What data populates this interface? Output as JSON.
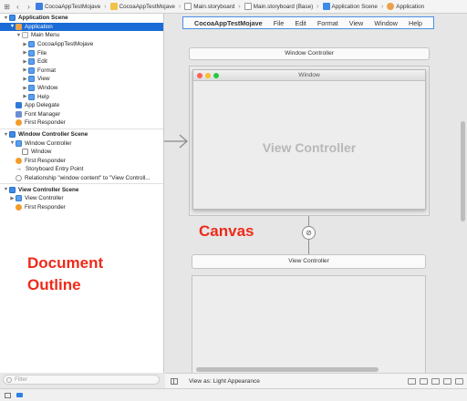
{
  "jumpbar": {
    "crumbs": [
      "CocoaAppTestMojave",
      "CocoaAppTestMojave",
      "Main.storyboard",
      "Main.storyboard (Base)",
      "Application Scene",
      "Application"
    ]
  },
  "outline": {
    "rows": [
      {
        "label": "Application Scene",
        "icon": "scene-icon",
        "tri": "▼"
      },
      {
        "label": "Application",
        "icon": "application-icon",
        "tri": "▼"
      },
      {
        "label": "Main Menu",
        "icon": "menu-icon",
        "tri": "▼"
      },
      {
        "label": "CocoaAppTestMojave",
        "icon": "menu-item-icon",
        "tri": "▶"
      },
      {
        "label": "File",
        "icon": "menu-item-icon",
        "tri": "▶"
      },
      {
        "label": "Edit",
        "icon": "menu-item-icon",
        "tri": "▶"
      },
      {
        "label": "Format",
        "icon": "menu-item-icon",
        "tri": "▶"
      },
      {
        "label": "View",
        "icon": "menu-item-icon",
        "tri": "▶"
      },
      {
        "label": "Window",
        "icon": "menu-item-icon",
        "tri": "▶"
      },
      {
        "label": "Help",
        "icon": "menu-item-icon",
        "tri": "▶"
      },
      {
        "label": "App Delegate",
        "icon": "cube-icon",
        "tri": ""
      },
      {
        "label": "Font Manager",
        "icon": "font-manager-icon",
        "tri": ""
      },
      {
        "label": "First Responder",
        "icon": "first-responder-icon",
        "tri": ""
      },
      {
        "label": "Window Controller Scene",
        "icon": "scene-icon",
        "tri": "▼"
      },
      {
        "label": "Window Controller",
        "icon": "window-controller-icon",
        "tri": "▼"
      },
      {
        "label": "Window",
        "icon": "window-icon",
        "tri": ""
      },
      {
        "label": "First Responder",
        "icon": "first-responder-icon",
        "tri": ""
      },
      {
        "label": "Storyboard Entry Point",
        "icon": "entry-arrow-icon",
        "tri": ""
      },
      {
        "label": "Relationship \"window content\" to \"View Controll...",
        "icon": "relationship-icon",
        "tri": ""
      },
      {
        "label": "View Controller Scene",
        "icon": "scene-icon",
        "tri": "▼"
      },
      {
        "label": "View Controller",
        "icon": "view-controller-icon",
        "tri": "▶"
      },
      {
        "label": "First Responder",
        "icon": "first-responder-icon",
        "tri": ""
      }
    ],
    "annotation_line1": "Document",
    "annotation_line2": "Outline",
    "filter_placeholder": "Filter"
  },
  "canvas": {
    "menubar": [
      "CocoaAppTestMojave",
      "File",
      "Edit",
      "Format",
      "View",
      "Window",
      "Help"
    ],
    "window_controller_title": "Window Controller",
    "window_title": "Window",
    "view_controller_placeholder": "View Controller",
    "annotation": "Canvas",
    "view_controller_title": "View Controller"
  },
  "bottombar": {
    "appearance": "View as: Light Appearance"
  },
  "colors": {
    "selection": "#1b6bd6",
    "annotation": "#ee2a1a",
    "traffic_red": "#fe5f57",
    "traffic_yellow": "#febc2e",
    "traffic_green": "#28c840"
  }
}
